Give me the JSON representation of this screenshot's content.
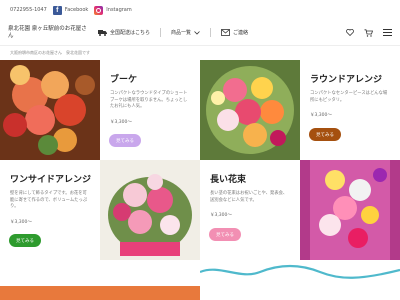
{
  "topbar": {
    "phone": "0722955-1047",
    "facebook": "Facebook",
    "instagram": "Instagram"
  },
  "header": {
    "shop_name": "泉北花園 泉ヶ丘駅前のお花屋さん",
    "nav": {
      "delivery": "全国配送はこちら",
      "products": "商品一覧",
      "contact": "ご連絡"
    }
  },
  "breadcrumb": {
    "items": [
      "大阪府堺市南区のお花屋さん",
      "泉北花園です"
    ]
  },
  "products": [
    {
      "title": "ブーケ",
      "desc": "コンパクトなラウンドタイプのショートブーケは場所を取りません。ちょっとしたお礼にも人気。",
      "price": "￥3,300～",
      "button": "見てみる",
      "button_color": "#c9a7ec"
    },
    {
      "title": "ラウンドアレンジ",
      "desc": "コンパクトなセンターピースはどんな場所にもピッタリ。",
      "price": "￥3,300～",
      "button": "見てみる",
      "button_color": "#a5500f"
    },
    {
      "title": "ワンサイドアレンジ",
      "desc": "壁を背にして飾るタイプです。お花を可能に寄せて作るので、ボリュームたっぷり。",
      "price": "￥3,300～",
      "button": "見てみる",
      "button_color": "#2e9b2e"
    },
    {
      "title": "長い花束",
      "desc": "長い茎の花束はお祝いごとや、発表会、送別会などに人気です。",
      "price": "￥3,300～",
      "button": "見てみる",
      "button_color": "#f28fb3"
    }
  ],
  "colors": {
    "bottom_bar": "#e8793c",
    "wave": "#4fb9cc"
  }
}
